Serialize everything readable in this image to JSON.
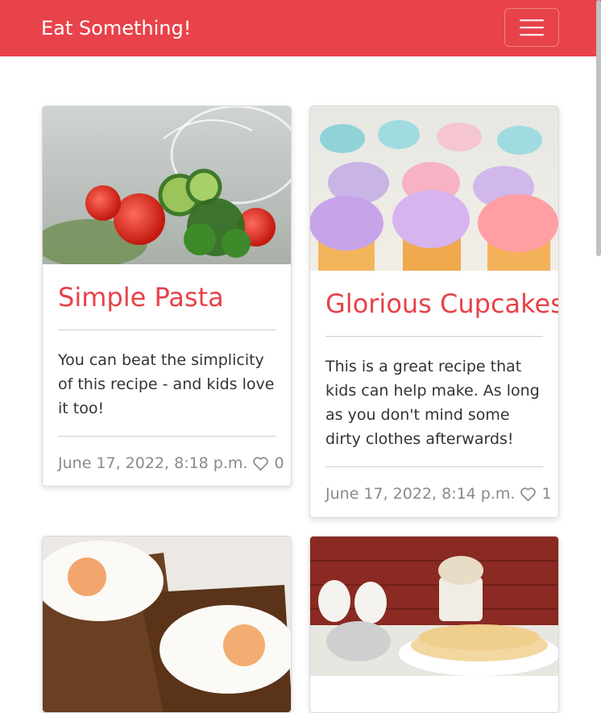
{
  "navbar": {
    "brand": "Eat Something!",
    "toggle_icon": "hamburger-menu-icon",
    "background": "#e8424a"
  },
  "recipes": [
    {
      "title": "Simple Pasta",
      "description": "You can beat the simplicity of this recipe - and kids love it too!",
      "date": "June 17, 2022, 8:18 p.m.",
      "likes": "0",
      "image_icon": "salad-photo"
    },
    {
      "title": "Glorious Cupcakes",
      "description": "This is a great recipe that kids can help make. As long as you don't mind some dirty clothes afterwards!",
      "date": "June 17, 2022, 8:14 p.m.",
      "likes": "1",
      "image_icon": "cupcakes-photo"
    },
    {
      "image_icon": "fried-eggs-toast-photo"
    },
    {
      "image_icon": "crepes-photo"
    }
  ],
  "colors": {
    "accent": "#e8424a",
    "muted_text": "#8a8a8a"
  }
}
